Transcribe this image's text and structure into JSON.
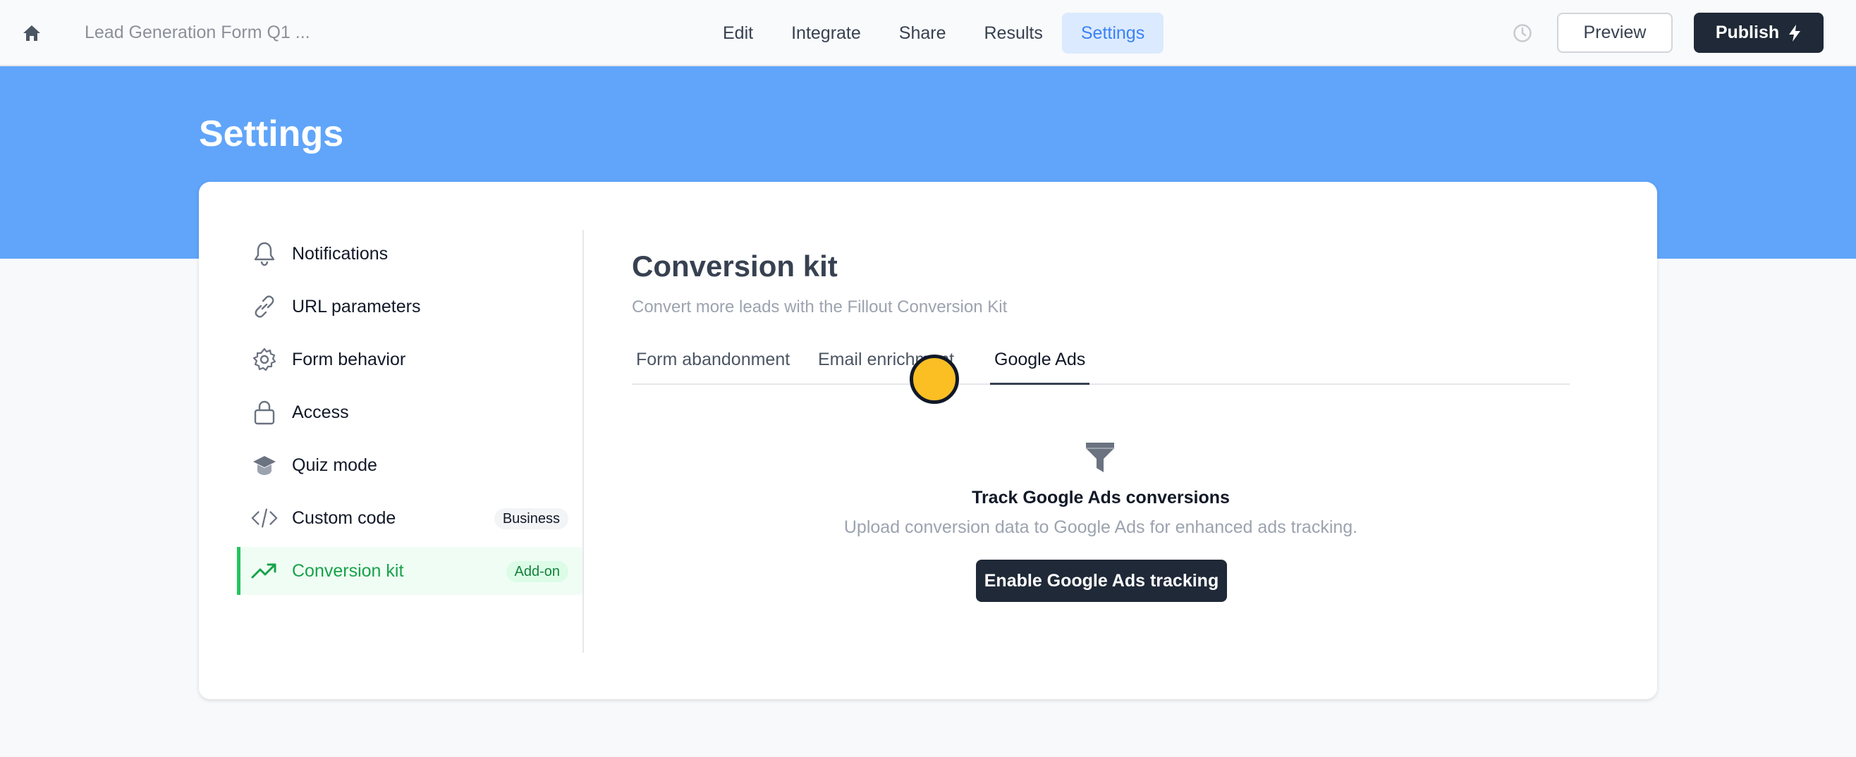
{
  "topbar": {
    "form_title": "Lead Generation Form Q1 ...",
    "nav_tabs": [
      {
        "label": "Edit",
        "active": false
      },
      {
        "label": "Integrate",
        "active": false
      },
      {
        "label": "Share",
        "active": false
      },
      {
        "label": "Results",
        "active": false
      },
      {
        "label": "Settings",
        "active": true
      }
    ],
    "preview_label": "Preview",
    "publish_label": "Publish",
    "icons": {
      "home": "home-icon",
      "history": "clock-icon",
      "publish": "lightning-icon"
    }
  },
  "banner": {
    "title": "Settings"
  },
  "sidebar": {
    "items": [
      {
        "label": "Notifications",
        "icon": "bell-icon",
        "badge": ""
      },
      {
        "label": "URL parameters",
        "icon": "link-icon",
        "badge": ""
      },
      {
        "label": "Form behavior",
        "icon": "gear-icon",
        "badge": ""
      },
      {
        "label": "Access",
        "icon": "lock-icon",
        "badge": ""
      },
      {
        "label": "Quiz mode",
        "icon": "graduation-cap-icon",
        "badge": ""
      },
      {
        "label": "Custom code",
        "icon": "code-icon",
        "badge": "Business"
      },
      {
        "label": "Conversion kit",
        "icon": "trending-up-icon",
        "badge": "Add-on",
        "active": true
      }
    ]
  },
  "main": {
    "title": "Conversion kit",
    "subtitle": "Convert more leads with the Fillout Conversion Kit",
    "tabs": [
      {
        "label": "Form abandonment",
        "active": false
      },
      {
        "label": "Email enrichment",
        "active": false
      },
      {
        "label": "Google Ads",
        "active": true
      }
    ],
    "empty_state": {
      "icon": "funnel-icon",
      "title": "Track Google Ads conversions",
      "description": "Upload conversion data to Google Ads for enhanced ads tracking.",
      "button_label": "Enable Google Ads tracking"
    }
  },
  "colors": {
    "banner": "#60a5fa",
    "active_tab_bg": "#dbeafe",
    "active_tab_text": "#3b82f6",
    "dark_button": "#1f2937",
    "accent_green": "#22c55e",
    "cursor": "#fbbf24"
  }
}
